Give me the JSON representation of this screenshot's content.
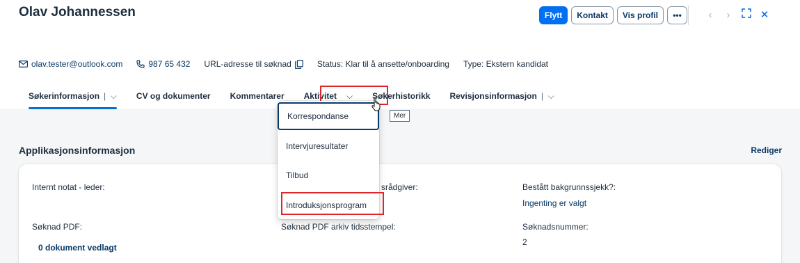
{
  "header": {
    "title": "Olav Johannessen",
    "actions": {
      "move": "Flytt",
      "contact": "Kontakt",
      "view_profile": "Vis profil",
      "more": "•••"
    },
    "nav": {
      "prev": "‹",
      "next": "›",
      "expand": "⤢",
      "close": "✕"
    }
  },
  "contact": {
    "email": "olav.tester@outlook.com",
    "phone": "987 65 432",
    "url_label": "URL-adresse til søknad",
    "status": "Status: Klar til å ansette/onboarding",
    "type": "Type: Ekstern kandidat"
  },
  "tabs": [
    {
      "label": "Søkerinformasjon"
    },
    {
      "label": "CV og dokumenter"
    },
    {
      "label": "Kommentarer"
    },
    {
      "label": "Aktivitet"
    },
    {
      "label": "Søkerhistorikk"
    },
    {
      "label": "Revisjonsinformasjon"
    }
  ],
  "tooltip": "Mer",
  "dropdown": {
    "items": [
      "Korrespondanse",
      "Intervjuresultater",
      "Tilbud",
      "Introduksjonsprogram"
    ]
  },
  "section": {
    "title": "Applikasjonsinformasjon",
    "edit": "Rediger"
  },
  "fields": {
    "internal_note_label": "Internt notat - leder:",
    "advisor_label": "srådgiver:",
    "background_label": "Bestått bakgrunnssjekk?:",
    "background_value": "Ingenting er valgt",
    "pdf_label": "Søknad PDF:",
    "pdf_value": "0 dokument vedlagt",
    "pdf_archive_label": "Søknad PDF arkiv tidsstempel:",
    "app_number_label": "Søknadsnummer:",
    "app_number_value": "2"
  },
  "colors": {
    "accent": "#0070f2",
    "link": "#0a3a66",
    "highlight": "#e0262a"
  }
}
